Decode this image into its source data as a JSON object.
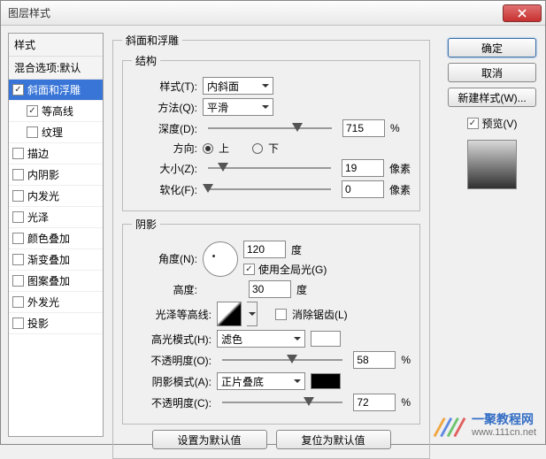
{
  "title": "图层样式",
  "sidebar": {
    "styles_head": "样式",
    "blend_head": "混合选项:默认",
    "items": [
      {
        "label": "斜面和浮雕",
        "checked": true,
        "active": true,
        "indent": false
      },
      {
        "label": "等高线",
        "checked": true,
        "active": false,
        "indent": true
      },
      {
        "label": "纹理",
        "checked": false,
        "active": false,
        "indent": true
      },
      {
        "label": "描边",
        "checked": false,
        "active": false,
        "indent": false
      },
      {
        "label": "内阴影",
        "checked": false,
        "active": false,
        "indent": false
      },
      {
        "label": "内发光",
        "checked": false,
        "active": false,
        "indent": false
      },
      {
        "label": "光泽",
        "checked": false,
        "active": false,
        "indent": false
      },
      {
        "label": "颜色叠加",
        "checked": false,
        "active": false,
        "indent": false
      },
      {
        "label": "渐变叠加",
        "checked": false,
        "active": false,
        "indent": false
      },
      {
        "label": "图案叠加",
        "checked": false,
        "active": false,
        "indent": false
      },
      {
        "label": "外发光",
        "checked": false,
        "active": false,
        "indent": false
      },
      {
        "label": "投影",
        "checked": false,
        "active": false,
        "indent": false
      }
    ]
  },
  "bevel": {
    "group_title": "斜面和浮雕",
    "structure_title": "结构",
    "style_label": "样式(T):",
    "style_value": "内斜面",
    "technique_label": "方法(Q):",
    "technique_value": "平滑",
    "depth_label": "深度(D):",
    "depth_value": "715",
    "pct": "%",
    "direction_label": "方向:",
    "up": "上",
    "down": "下",
    "size_label": "大小(Z):",
    "size_value": "19",
    "px": "像素",
    "soften_label": "软化(F):",
    "soften_value": "0"
  },
  "shadow": {
    "group_title": "阴影",
    "angle_label": "角度(N):",
    "angle_value": "120",
    "deg": "度",
    "global_light": "使用全局光(G)",
    "altitude_label": "高度:",
    "altitude_value": "30",
    "gloss_label": "光泽等高线:",
    "antialias": "消除锯齿(L)",
    "highlight_mode_label": "高光模式(H):",
    "highlight_mode_value": "滤色",
    "highlight_opacity_label": "不透明度(O):",
    "highlight_opacity_value": "58",
    "shadow_mode_label": "阴影模式(A):",
    "shadow_mode_value": "正片叠底",
    "shadow_opacity_label": "不透明度(C):",
    "shadow_opacity_value": "72",
    "pct": "%"
  },
  "buttons": {
    "ok": "确定",
    "cancel": "取消",
    "new_style": "新建样式(W)...",
    "preview": "预览(V)",
    "set_default": "设置为默认值",
    "reset_default": "复位为默认值"
  },
  "watermark": {
    "name": "一聚教程网",
    "url": "www.111cn.net"
  }
}
